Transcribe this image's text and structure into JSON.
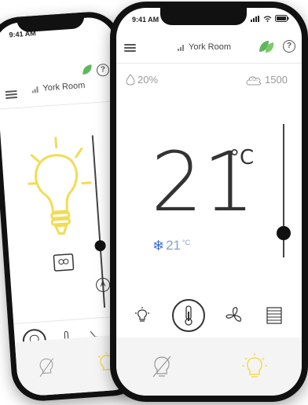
{
  "front": {
    "status_time": "9:41 AM",
    "room_name": "York Room",
    "humidity": "20%",
    "co2_label": "CO₂",
    "co2_value": "1500",
    "temperature": "21",
    "temperature_unit": "°C",
    "setpoint_temp": "21",
    "setpoint_unit": "°C",
    "slider_level": 0.28,
    "help_label": "?"
  },
  "back": {
    "status_time": "9:41 AM",
    "room_name": "York Room",
    "slider_level": 0.2,
    "auto_label": "A",
    "help_label": "?"
  },
  "colors": {
    "bulb_yellow": "#f2dc54",
    "leaf_green": "#5cb85c",
    "snow_blue": "#3d6fd6",
    "text_dark": "#333333"
  },
  "icons": {
    "modes": [
      "light-bulb-icon",
      "thermometer-icon",
      "fan-icon",
      "blinds-icon"
    ],
    "bottom_nav": [
      "light-off-icon",
      "light-on-icon"
    ]
  }
}
